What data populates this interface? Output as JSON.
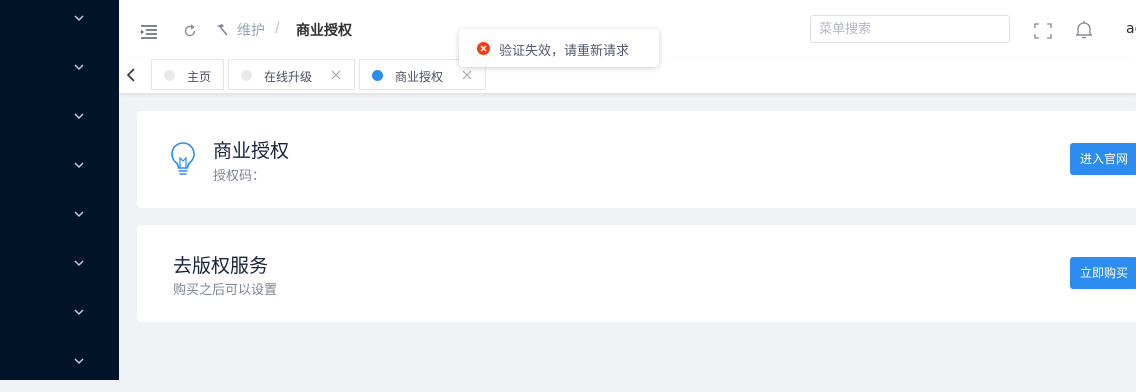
{
  "sidebar": {
    "items": [
      {
        "icon": "chevron-down-icon"
      },
      {
        "icon": "chevron-down-icon"
      },
      {
        "icon": "chevron-down-icon"
      },
      {
        "icon": "chevron-down-icon"
      },
      {
        "icon": "chevron-down-icon"
      },
      {
        "icon": "chevron-down-icon"
      },
      {
        "icon": "chevron-down-icon"
      },
      {
        "icon": "chevron-down-icon"
      }
    ]
  },
  "header": {
    "breadcrumb": [
      "维护",
      "商业授权"
    ],
    "separator": "/",
    "search_placeholder": "菜单搜索",
    "user": "ad",
    "icons": [
      "menu-toggle-icon",
      "refresh-icon",
      "hammer-icon",
      "fullscreen-icon",
      "bell-icon"
    ]
  },
  "tabs": [
    {
      "label": "主页",
      "active": false,
      "closable": false
    },
    {
      "label": "在线升级",
      "active": false,
      "closable": true
    },
    {
      "label": "商业授权",
      "active": true,
      "closable": true
    }
  ],
  "cards": {
    "license": {
      "title": "商业授权",
      "subtitle": "授权码：",
      "button": "进入官网",
      "icon": "lightbulb-icon"
    },
    "copyright": {
      "title": "去版权服务",
      "subtitle": "购买之后可以设置",
      "button": "立即购买"
    }
  },
  "toast": {
    "message": "验证失效，请重新请求",
    "type": "error"
  },
  "colors": {
    "sidebar": "#001529",
    "primary": "#2d8cf0",
    "error": "#ed4014",
    "background": "#f0f2f5"
  }
}
